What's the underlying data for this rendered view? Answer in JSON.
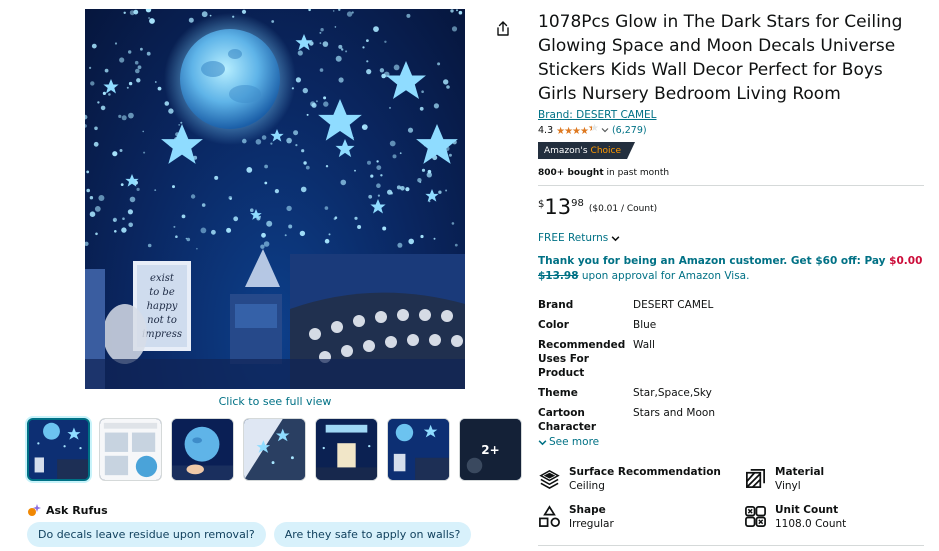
{
  "product": {
    "title": "1078Pcs Glow in The Dark Stars for Ceiling Glowing Space and Moon Decals Universe Stickers Kids Wall Decor Perfect for Boys Girls Nursery Bedroom Living Room",
    "brand_link": "Brand: DESERT CAMEL",
    "rating_value": "4.3",
    "rating_count": "(6,279)",
    "badge_prefix": "Amazon's",
    "badge_choice": "Choice",
    "bought_bold": "800+ bought",
    "bought_rest": " in past month"
  },
  "price": {
    "symbol": "$",
    "whole": "13",
    "fraction": "98",
    "per_unit": "($0.01 / Count)"
  },
  "returns_label": "FREE Returns",
  "promo": {
    "lead": "Thank you for being an Amazon customer. Get $60 off: Pay ",
    "new_price": "$0.00",
    "old_price": "$13.98",
    "tail": " upon approval for Amazon Visa."
  },
  "specs": [
    {
      "key": "Brand",
      "value": "DESERT CAMEL"
    },
    {
      "key": "Color",
      "value": "Blue"
    },
    {
      "key": "Recommended Uses For Product",
      "value": "Wall"
    },
    {
      "key": "Theme",
      "value": "Star,Space,Sky"
    },
    {
      "key": "Cartoon Character",
      "value": "Stars and Moon"
    }
  ],
  "see_more": "See more",
  "features": [
    {
      "key": "Surface Recommendation",
      "value": "Ceiling",
      "icon": "surface-icon"
    },
    {
      "key": "Material",
      "value": "Vinyl",
      "icon": "material-icon"
    },
    {
      "key": "Shape",
      "value": "Irregular",
      "icon": "shape-icon"
    },
    {
      "key": "Unit Count",
      "value": "1108.0 Count",
      "icon": "unit-count-icon"
    }
  ],
  "media": {
    "click_full": "Click to see full view",
    "more_thumbs": "2+",
    "poster_lines": [
      "exist",
      "to be",
      "happy",
      "not to",
      "impress"
    ]
  },
  "rufus": {
    "label": "Ask Rufus",
    "chips": [
      "Do decals leave residue upon removal?",
      "Are they safe to apply on walls?"
    ]
  },
  "colors": {
    "link": "#007185",
    "star": "#de7921",
    "badge_bg": "#232f3e",
    "badge_accent": "#ff9900",
    "promo_red": "#cc0c39",
    "glow": "#9fe6ff"
  }
}
